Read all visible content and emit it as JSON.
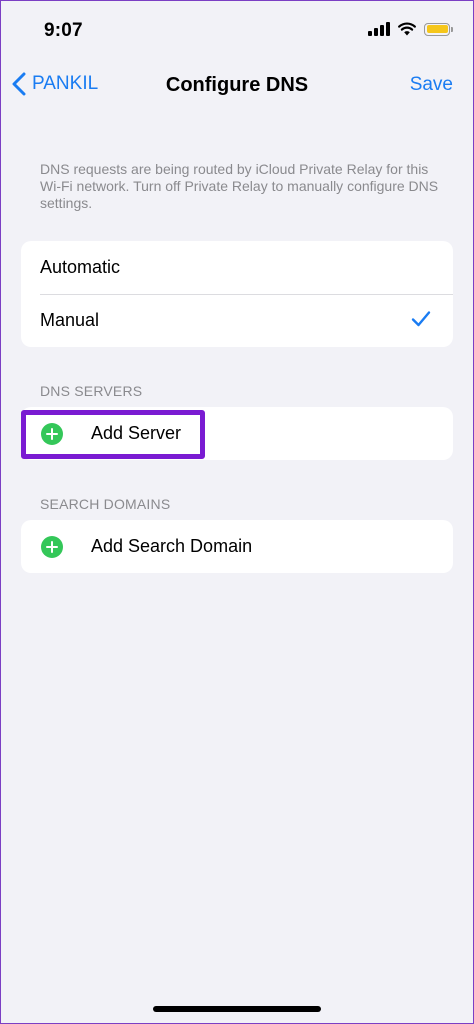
{
  "status_bar": {
    "time": "9:07"
  },
  "nav": {
    "back_label": "PANKIL",
    "title": "Configure DNS",
    "save_label": "Save"
  },
  "notice": "DNS requests are being routed by iCloud Private Relay for this Wi-Fi network. Turn off Private Relay to manually configure DNS settings.",
  "mode_options": [
    {
      "label": "Automatic",
      "selected": false
    },
    {
      "label": "Manual",
      "selected": true
    }
  ],
  "dns_servers": {
    "header": "DNS SERVERS",
    "add_label": "Add Server"
  },
  "search_domains": {
    "header": "SEARCH DOMAINS",
    "add_label": "Add Search Domain"
  },
  "colors": {
    "accent": "#1a7cf2",
    "add_green": "#34c759",
    "highlight": "#7a1bd2",
    "background": "#f2f2f7"
  }
}
